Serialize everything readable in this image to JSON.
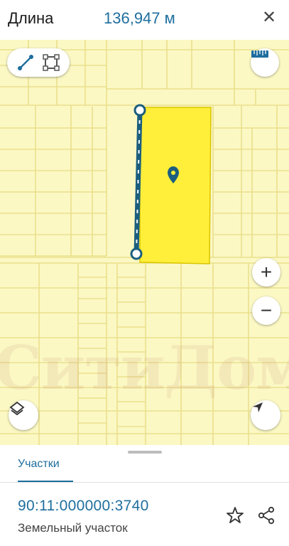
{
  "header": {
    "label": "Длина",
    "value": "136,947 м",
    "close_icon": "close-icon"
  },
  "map": {
    "watermark": "СитиДом",
    "selected_parcel_color": "#ffef3a",
    "parcel_fill_color": "#fbf8c4",
    "parcel_border_color": "#eadf8c",
    "measure_line_color": "#1b5e7e",
    "icons": {
      "line_tool": "line-tool-icon",
      "polygon_tool": "polygon-tool-icon",
      "ruler": "ruler-icon",
      "zoom_in": "plus-icon",
      "zoom_out": "minus-icon",
      "layers": "layers-icon",
      "location": "navigation-arrow-icon",
      "marker": "map-pin-icon"
    }
  },
  "sheet": {
    "tab_label": "Участки",
    "cadastral_number": "90:11:000000:3740",
    "parcel_type": "Земельный участок"
  }
}
